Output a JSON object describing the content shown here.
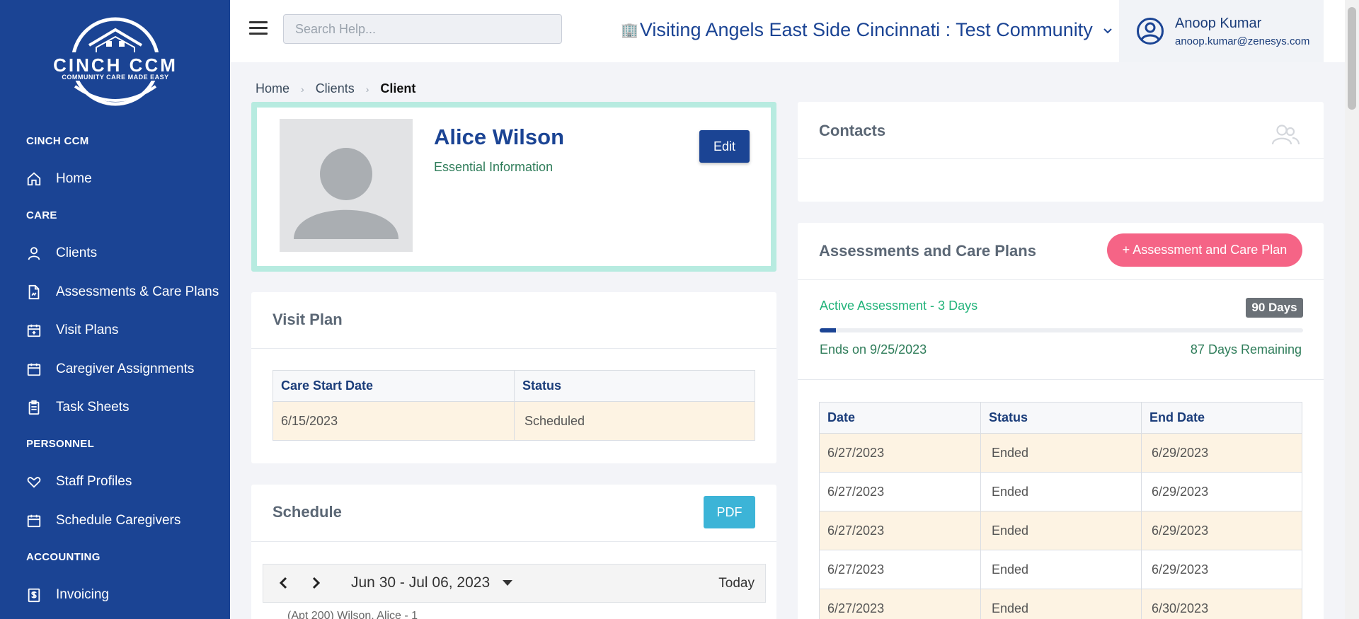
{
  "sidebar": {
    "logo_text": "CINCH CCM",
    "logo_tagline": "COMMUNITY CARE MADE EASY",
    "sections": {
      "cinch": "CINCH CCM",
      "care": "CARE",
      "personnel": "PERSONNEL",
      "accounting": "ACCOUNTING"
    },
    "items": {
      "home": "Home",
      "clients": "Clients",
      "assessments": "Assessments & Care Plans",
      "visit_plans": "Visit Plans",
      "caregiver_assignments": "Caregiver Assignments",
      "task_sheets": "Task Sheets",
      "staff_profiles": "Staff Profiles",
      "schedule_caregivers": "Schedule Caregivers",
      "invoicing": "Invoicing"
    }
  },
  "header": {
    "search_placeholder": "Search Help...",
    "community": "Visiting Angels East Side Cincinnati : Test Community",
    "user_name": "Anoop Kumar",
    "user_email": "anoop.kumar@zenesys.com"
  },
  "breadcrumb": {
    "home": "Home",
    "clients": "Clients",
    "current": "Client"
  },
  "profile": {
    "name": "Alice Wilson",
    "subtitle": "Essential Information",
    "edit_label": "Edit"
  },
  "visit_plan": {
    "title": "Visit Plan",
    "headers": [
      "Care Start Date",
      "Status"
    ],
    "rows": [
      [
        "6/15/2023",
        "Scheduled"
      ]
    ]
  },
  "schedule": {
    "title": "Schedule",
    "pdf_label": "PDF",
    "range": "Jun 30 - Jul 06, 2023",
    "today_label": "Today",
    "partial_row": "(Apt 200) Wilson, Alice - 1"
  },
  "contacts": {
    "title": "Contacts"
  },
  "assessments": {
    "title": "Assessments and Care Plans",
    "add_label": "+  Assessment and Care Plan",
    "active_label": "Active Assessment - 3 Days",
    "days_badge": "90 Days",
    "progress_fraction": 0.033,
    "ends_on": "Ends on 9/25/2023",
    "remaining": "87 Days Remaining",
    "headers": [
      "Date",
      "Status",
      "End Date"
    ],
    "rows": [
      [
        "6/27/2023",
        "Ended",
        "6/29/2023"
      ],
      [
        "6/27/2023",
        "Ended",
        "6/29/2023"
      ],
      [
        "6/27/2023",
        "Ended",
        "6/29/2023"
      ],
      [
        "6/27/2023",
        "Ended",
        "6/29/2023"
      ],
      [
        "6/27/2023",
        "Ended",
        "6/30/2023"
      ]
    ]
  },
  "colors": {
    "sidebar": "#1b4494",
    "primary": "#1b4494",
    "accent_pink": "#f56486",
    "pdf_blue": "#3cb4d7",
    "profile_border": "#b7ebe0",
    "row_highlight": "#fdf3e3"
  }
}
